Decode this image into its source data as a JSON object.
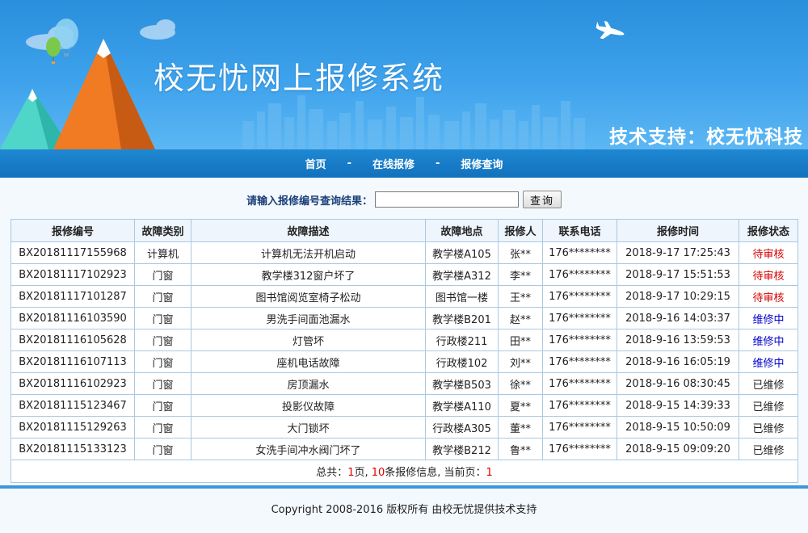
{
  "header": {
    "title": "校无忧网上报修系统",
    "tech_support": "技术支持：校无忧科技"
  },
  "nav": {
    "items": [
      "首页",
      "在线报修",
      "报修查询"
    ],
    "separator": "-"
  },
  "search": {
    "label": "请输入报修编号查询结果：",
    "value": "",
    "placeholder": "",
    "button": "查询"
  },
  "table": {
    "columns": [
      "报修编号",
      "故障类别",
      "故障描述",
      "故障地点",
      "报修人",
      "联系电话",
      "报修时间",
      "报修状态"
    ],
    "rows": [
      {
        "id": "BX20181117155968",
        "category": "计算机",
        "desc": "计算机无法开机启动",
        "location": "教学楼A105",
        "reporter": "张**",
        "phone": "176********",
        "time": "2018-9-17 17:25:43",
        "status": "待审核",
        "status_type": "pending"
      },
      {
        "id": "BX20181117102923",
        "category": "门窗",
        "desc": "教学楼312窗户坏了",
        "location": "教学楼A312",
        "reporter": "李**",
        "phone": "176********",
        "time": "2018-9-17 15:51:53",
        "status": "待审核",
        "status_type": "pending"
      },
      {
        "id": "BX20181117101287",
        "category": "门窗",
        "desc": "图书馆阅览室椅子松动",
        "location": "图书馆一楼",
        "reporter": "王**",
        "phone": "176********",
        "time": "2018-9-17 10:29:15",
        "status": "待审核",
        "status_type": "pending"
      },
      {
        "id": "BX20181116103590",
        "category": "门窗",
        "desc": "男洗手间面池漏水",
        "location": "教学楼B201",
        "reporter": "赵**",
        "phone": "176********",
        "time": "2018-9-16 14:03:37",
        "status": "维修中",
        "status_type": "repairing"
      },
      {
        "id": "BX20181116105628",
        "category": "门窗",
        "desc": "灯管坏",
        "location": "行政楼211",
        "reporter": "田**",
        "phone": "176********",
        "time": "2018-9-16 13:59:53",
        "status": "维修中",
        "status_type": "repairing"
      },
      {
        "id": "BX20181116107113",
        "category": "门窗",
        "desc": "座机电话故障",
        "location": "行政楼102",
        "reporter": "刘**",
        "phone": "176********",
        "time": "2018-9-16 16:05:19",
        "status": "维修中",
        "status_type": "repairing"
      },
      {
        "id": "BX20181116102923",
        "category": "门窗",
        "desc": "房顶漏水",
        "location": "教学楼B503",
        "reporter": "徐**",
        "phone": "176********",
        "time": "2018-9-16 08:30:45",
        "status": "已维修",
        "status_type": "done"
      },
      {
        "id": "BX20181115123467",
        "category": "门窗",
        "desc": "投影仪故障",
        "location": "教学楼A110",
        "reporter": "夏**",
        "phone": "176********",
        "time": "2018-9-15 14:39:33",
        "status": "已维修",
        "status_type": "done"
      },
      {
        "id": "BX20181115129263",
        "category": "门窗",
        "desc": "大门锁坏",
        "location": "行政楼A305",
        "reporter": "董**",
        "phone": "176********",
        "time": "2018-9-15 10:50:09",
        "status": "已维修",
        "status_type": "done"
      },
      {
        "id": "BX20181115133123",
        "category": "门窗",
        "desc": "女洗手间冲水阀门坏了",
        "location": "教学楼B212",
        "reporter": "鲁**",
        "phone": "176********",
        "time": "2018-9-15 09:09:20",
        "status": "已维修",
        "status_type": "done"
      }
    ],
    "summary": {
      "prefix": "总共：",
      "pages": "1",
      "mid1": "页, ",
      "records": "10",
      "mid2": "条报修信息, 当前页：",
      "current": "1"
    }
  },
  "footer": {
    "copyright": "Copyright 2008-2016 版权所有 由校无忧提供技术支持"
  },
  "colors": {
    "pending": "#d40000",
    "repairing": "#0000cc",
    "nav_bg": "#1271bd",
    "banner_bg": "#3ea2ec"
  }
}
